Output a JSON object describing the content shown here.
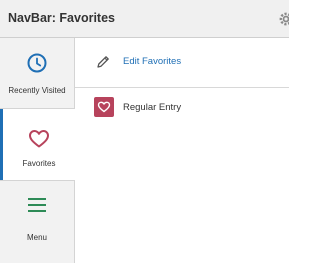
{
  "header": {
    "title": "NavBar: Favorites",
    "settings_icon": "gear-icon"
  },
  "sidebar": {
    "items": [
      {
        "label": "Recently Visited",
        "icon": "clock-icon",
        "selected": false
      },
      {
        "label": "Favorites",
        "icon": "heart-icon",
        "selected": true
      },
      {
        "label": "Menu",
        "icon": "menu-icon",
        "selected": false
      }
    ]
  },
  "main": {
    "edit_favorites": {
      "label": "Edit Favorites",
      "icon": "pencil-icon"
    },
    "favorites": [
      {
        "label": "Regular Entry",
        "icon": "heart-icon"
      }
    ]
  },
  "colors": {
    "accent": "#1f6fb5",
    "favorite_tile": "#b7435c",
    "menu_icon": "#2e8b57"
  }
}
